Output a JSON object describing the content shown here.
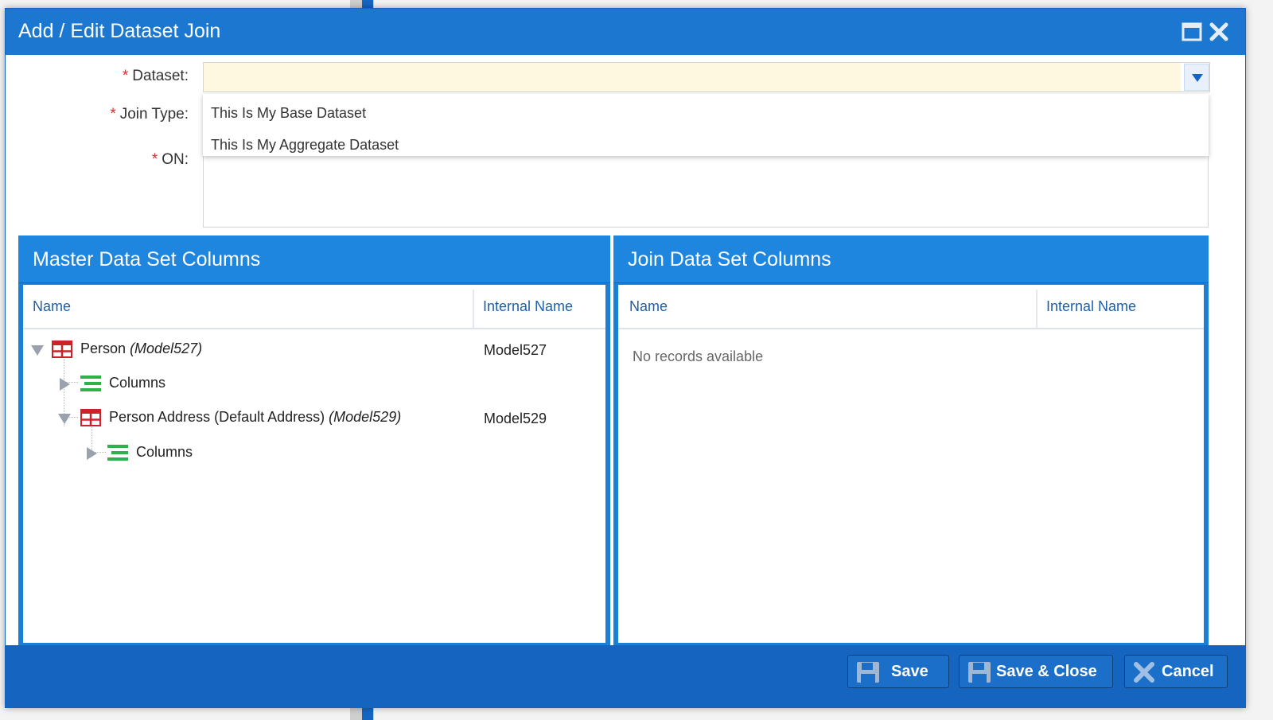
{
  "dialog": {
    "title": "Add / Edit Dataset Join"
  },
  "form": {
    "dataset_label": "Dataset:",
    "join_type_label": "Join Type:",
    "on_label": "ON:",
    "required_marker": "*",
    "dataset_value": "",
    "dropdown_options": [
      "This Is My Base Dataset",
      "This Is My Aggregate Dataset"
    ]
  },
  "master_panel": {
    "title": "Master Data Set Columns",
    "col_name": "Name",
    "col_internal": "Internal Name",
    "rows": [
      {
        "name": "Person",
        "model": "(Model527)",
        "internal": "Model527",
        "icon": "table-icon"
      },
      {
        "name": "Columns",
        "model": "",
        "internal": "",
        "icon": "columns-icon"
      },
      {
        "name": "Person Address (Default Address)",
        "model": "(Model529)",
        "internal": "Model529",
        "icon": "table-icon"
      },
      {
        "name": "Columns",
        "model": "",
        "internal": "",
        "icon": "columns-icon"
      }
    ]
  },
  "join_panel": {
    "title": "Join Data Set Columns",
    "col_name": "Name",
    "col_internal": "Internal Name",
    "empty_text": "No records available"
  },
  "footer": {
    "save": "Save",
    "save_close": "Save & Close",
    "cancel": "Cancel"
  },
  "colors": {
    "header_blue": "#1b77cf",
    "panel_blue": "#1f86e0",
    "footer_blue": "#1565c0",
    "required_red": "#d32f2f",
    "input_highlight": "#fff8e0"
  }
}
